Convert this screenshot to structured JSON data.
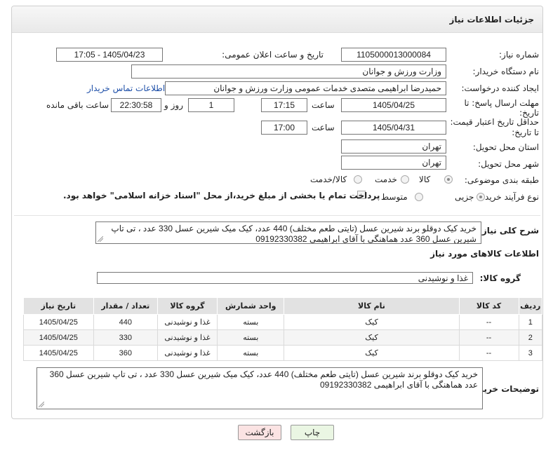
{
  "panel": {
    "title": "جزئیات اطلاعات نیاز"
  },
  "form": {
    "need_number_label": "شماره نیاز:",
    "need_number": "1105000013000084",
    "announce_label": "تاریخ و ساعت اعلان عمومی:",
    "announce_value": "1405/04/23 - 17:05",
    "buyer_org_label": "نام دستگاه خریدار:",
    "buyer_org": "وزارت ورزش و جوانان",
    "requester_label": "ایجاد کننده درخواست:",
    "requester": "حمیدرضا ابراهیمی متصدی خدمات عمومی وزارت ورزش و جوانان",
    "contact_link": "اطلاعات تماس خریدار",
    "deadline_label_1": "مهلت ارسال پاسخ: تا",
    "deadline_label_2": "تاریخ:",
    "deadline_date": "1405/04/25",
    "time_label": "ساعت",
    "deadline_time": "17:15",
    "days_value": "1",
    "days_label": "روز و",
    "remaining_time": "22:30:58",
    "remaining_label": "ساعت باقی مانده",
    "validity_label_1": "حداقل تاریخ اعتبار قیمت:",
    "validity_label_2": "تا تاریخ:",
    "validity_date": "1405/04/31",
    "validity_time": "17:00",
    "province_label": "استان محل تحویل:",
    "province": "تهران",
    "city_label": "شهر محل تحویل:",
    "city": "تهران",
    "category_label": "طبقه بندی موضوعی:",
    "category_options": [
      "کالا",
      "خدمت",
      "کالا/خدمت"
    ],
    "category_selected": "کالا",
    "process_label": "نوع فرآیند خرید :",
    "process_options": [
      "جزیی",
      "متوسط"
    ],
    "process_selected": "جزیی",
    "payment_note": "پرداخت تمام یا بخشی از مبلغ خرید،از محل \"اسناد خزانه اسلامی\" خواهد بود."
  },
  "description": {
    "label": "شرح کلی نیاز:",
    "text": "خرید کیک دوقلو برند شیرین عسل  (تایتی طعم مختلف)  440 عدد، کیک میک شیرین عسل 330 عدد ، تی تاپ شیرین عسل 360 عدد هماهنگی با آقای ابراهیمی 09192330382"
  },
  "goods": {
    "section_title": "اطلاعات کالاهای مورد نیاز",
    "group_label": "گروه کالا:",
    "group_value": "غذا و نوشیدنی",
    "columns": [
      "ردیف",
      "کد کالا",
      "نام کالا",
      "واحد شمارش",
      "گروه کالا",
      "تعداد / مقدار",
      "تاریخ نیاز"
    ],
    "rows": [
      [
        "1",
        "--",
        "کیک",
        "بسته",
        "غذا و نوشیدنی",
        "440",
        "1405/04/25"
      ],
      [
        "2",
        "--",
        "کیک",
        "بسته",
        "غذا و نوشیدنی",
        "330",
        "1405/04/25"
      ],
      [
        "3",
        "--",
        "کیک",
        "بسته",
        "غذا و نوشیدنی",
        "360",
        "1405/04/25"
      ]
    ]
  },
  "buyer_notes": {
    "label": "توضیحات خریدار:",
    "text": "خرید کیک دوقلو برند شیرین عسل  (تایتی طعم مختلف)  440 عدد، کیک میک شیرین عسل 330 عدد ، تی تاپ شیرین عسل 360 عدد هماهنگی با آقای ابراهیمی 09192330382"
  },
  "buttons": {
    "print": "چاپ",
    "back": "بازگشت"
  },
  "watermark": "AriaTender.net",
  "colors": {
    "link": "#1e4fa8",
    "print_bg": "#eaf6e3",
    "back_bg": "#fbe3e3"
  }
}
